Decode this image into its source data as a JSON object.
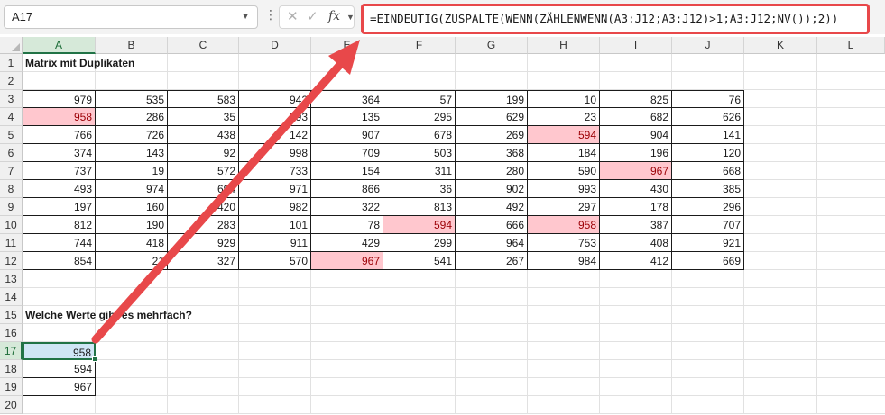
{
  "name_box": "A17",
  "formula": "=EINDEUTIG(ZUSPALTE(WENN(ZÄHLENWENN(A3:J12;A3:J12)>1;A3:J12;NV());2))",
  "columns": [
    "A",
    "B",
    "C",
    "D",
    "E",
    "F",
    "G",
    "H",
    "I",
    "J",
    "K",
    "L"
  ],
  "rows": [
    "1",
    "2",
    "3",
    "4",
    "5",
    "6",
    "7",
    "8",
    "9",
    "10",
    "11",
    "12",
    "13",
    "14",
    "15",
    "16",
    "17",
    "18",
    "19",
    "20"
  ],
  "titles": {
    "matrix": "Matrix mit Duplikaten",
    "question": "Welche Werte gibt es mehrfach?"
  },
  "matrix": [
    [
      979,
      535,
      583,
      942,
      364,
      57,
      199,
      10,
      825,
      76
    ],
    [
      958,
      286,
      35,
      593,
      135,
      295,
      629,
      23,
      682,
      626
    ],
    [
      766,
      726,
      438,
      142,
      907,
      678,
      269,
      594,
      904,
      141
    ],
    [
      374,
      143,
      92,
      998,
      709,
      503,
      368,
      184,
      196,
      120
    ],
    [
      737,
      19,
      572,
      733,
      154,
      311,
      280,
      590,
      967,
      668
    ],
    [
      493,
      974,
      694,
      971,
      866,
      36,
      902,
      993,
      430,
      385
    ],
    [
      197,
      160,
      420,
      982,
      322,
      813,
      492,
      297,
      178,
      296
    ],
    [
      812,
      190,
      283,
      101,
      78,
      594,
      666,
      958,
      387,
      707
    ],
    [
      744,
      418,
      929,
      911,
      429,
      299,
      964,
      753,
      408,
      921
    ],
    [
      854,
      21,
      327,
      570,
      967,
      541,
      267,
      984,
      412,
      669
    ]
  ],
  "duplicates": [
    [
      1,
      0
    ],
    [
      2,
      7
    ],
    [
      4,
      8
    ],
    [
      7,
      5
    ],
    [
      7,
      7
    ],
    [
      9,
      4
    ]
  ],
  "results": [
    958,
    594,
    967
  ],
  "colors": {
    "accent": "#217346",
    "dup_fill": "#ffc7ce",
    "dup_text": "#9c0006",
    "annotation": "#e8484a"
  },
  "icons": {
    "cancel": "cancel-icon",
    "confirm": "check-icon",
    "function": "fx-icon"
  }
}
